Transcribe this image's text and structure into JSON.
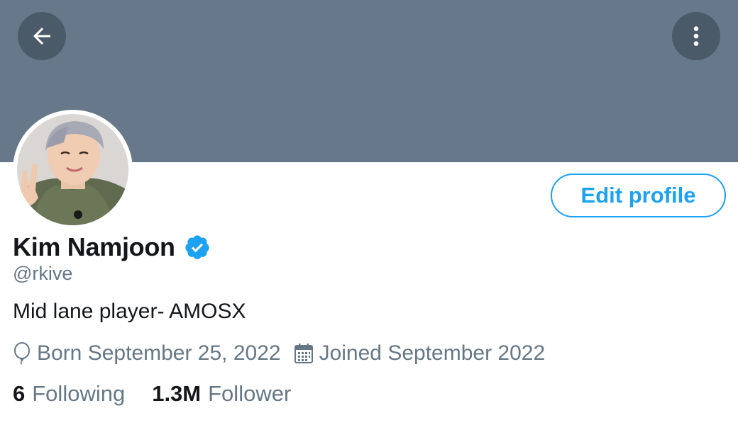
{
  "header": {
    "back_icon": "arrow-left-icon",
    "more_icon": "more-vertical-icon",
    "banner_color": "#667889"
  },
  "profile": {
    "name": "Kim Namjoon",
    "verified": true,
    "handle": "@rkive",
    "bio": "Mid lane player- AMOSX",
    "born_icon": "balloon-icon",
    "born": "Born September 25, 2022",
    "joined_icon": "calendar-icon",
    "joined": "Joined September 2022",
    "edit_button_label": "Edit profile"
  },
  "stats": {
    "following_count": "6",
    "following_label": "Following",
    "followers_count": "1.3M",
    "followers_label": "Follower"
  },
  "colors": {
    "accent": "#1da1f2",
    "secondary_text": "#657786",
    "primary_text": "#14171a"
  }
}
